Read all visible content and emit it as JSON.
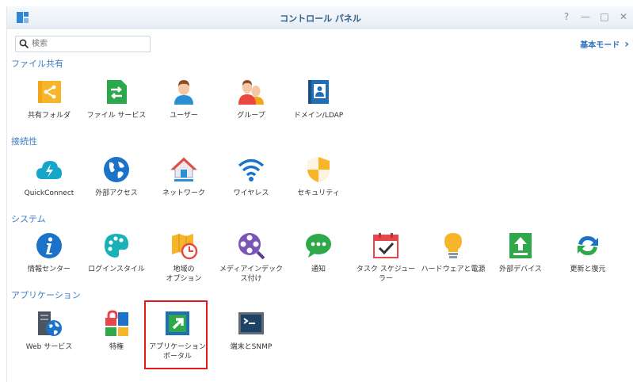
{
  "window": {
    "title": "コントロール パネル"
  },
  "window_controls": {
    "help": "?",
    "minimize": "—",
    "maximize": "□",
    "close": "✕"
  },
  "search": {
    "placeholder": "検索"
  },
  "mode_link": {
    "label": "基本モード",
    "chevron": "›"
  },
  "sections": [
    {
      "label": "ファイル共有",
      "items": [
        {
          "label": "共有フォルダ",
          "icon": "shared-folder-icon"
        },
        {
          "label": "ファイル サービス",
          "icon": "file-services-icon"
        },
        {
          "label": "ユーザー",
          "icon": "user-icon"
        },
        {
          "label": "グループ",
          "icon": "group-icon"
        },
        {
          "label": "ドメイン/LDAP",
          "icon": "domain-ldap-icon"
        }
      ]
    },
    {
      "label": "接続性",
      "items": [
        {
          "label": "QuickConnect",
          "icon": "quickconnect-icon"
        },
        {
          "label": "外部アクセス",
          "icon": "external-access-icon"
        },
        {
          "label": "ネットワーク",
          "icon": "network-icon"
        },
        {
          "label": "ワイヤレス",
          "icon": "wireless-icon"
        },
        {
          "label": "セキュリティ",
          "icon": "security-icon"
        }
      ]
    },
    {
      "label": "システム",
      "items": [
        {
          "label": "情報センター",
          "icon": "info-center-icon"
        },
        {
          "label": "ログインスタイル",
          "icon": "login-style-icon"
        },
        {
          "label": "地域の\nオプション",
          "icon": "regional-options-icon"
        },
        {
          "label": "メディアインデック\nス付け",
          "icon": "media-indexing-icon"
        },
        {
          "label": "通知",
          "icon": "notification-icon"
        },
        {
          "label": "タスク スケジュー\nラー",
          "icon": "task-scheduler-icon"
        },
        {
          "label": "ハードウェアと電源",
          "icon": "hardware-power-icon"
        },
        {
          "label": "外部デバイス",
          "icon": "external-devices-icon"
        },
        {
          "label": "更新と復元",
          "icon": "update-restore-icon"
        }
      ]
    },
    {
      "label": "アプリケーション",
      "items": [
        {
          "label": "Web サービス",
          "icon": "web-services-icon"
        },
        {
          "label": "特権",
          "icon": "privileges-icon"
        },
        {
          "label": "アプリケーション\nポータル",
          "icon": "application-portal-icon"
        },
        {
          "label": "端末とSNMP",
          "icon": "terminal-snmp-icon"
        }
      ]
    }
  ],
  "colors": {
    "accent": "#3a7ec6",
    "highlight": "#e21a1a"
  }
}
